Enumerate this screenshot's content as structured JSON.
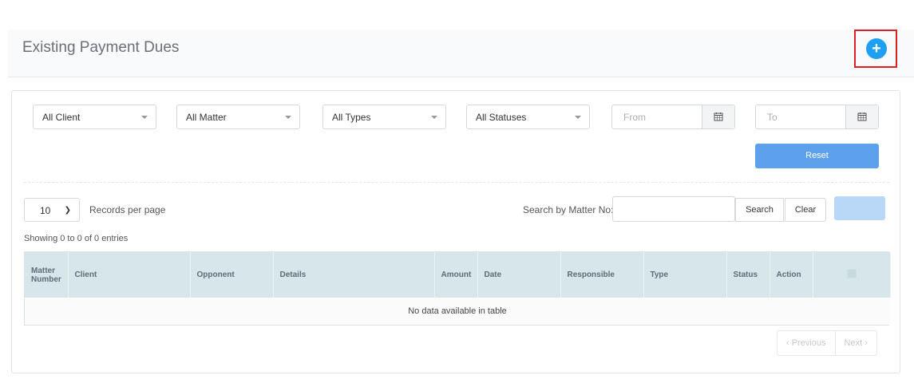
{
  "header": {
    "title": "Existing Payment Dues",
    "add_button": "+",
    "accent_color": "#1e9ff2",
    "highlight_color": "#e02020"
  },
  "filters": {
    "client": "All Client",
    "matter": "All Matter",
    "types": "All Types",
    "statuses": "All Statuses",
    "from_placeholder": "From",
    "to_placeholder": "To",
    "reset_label": "Reset"
  },
  "table_controls": {
    "records_value": "10",
    "records_label": "Records per page",
    "search_label": "Search by Matter No:",
    "search_button": "Search",
    "clear_button": "Clear",
    "info": "Showing 0 to 0 of 0 entries"
  },
  "table": {
    "columns": [
      "Matter Number",
      "Client",
      "Opponent",
      "Details",
      "Amount",
      "Date",
      "Responsible",
      "Type",
      "Status",
      "Action"
    ],
    "empty_message": "No data available in table"
  },
  "pagination": {
    "previous": "‹ Previous",
    "next": "Next ›"
  }
}
